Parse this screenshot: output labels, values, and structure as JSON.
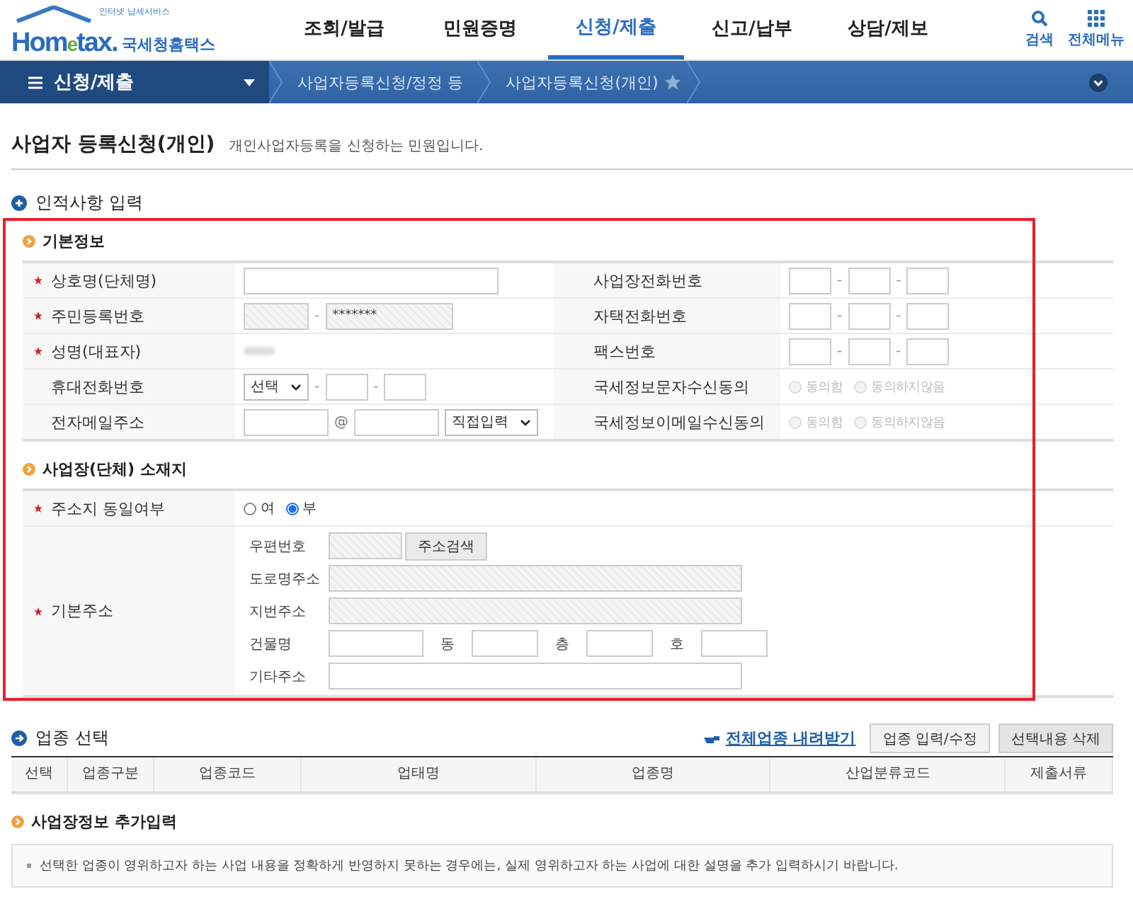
{
  "header": {
    "logo": {
      "tagline": "인터넷 납세서비스",
      "brand_a": "Hom",
      "brand_b": "e",
      "brand_c": "tax.",
      "name": "국세청홈택스"
    },
    "nav": [
      {
        "label": "조회/발급",
        "selected": false
      },
      {
        "label": "민원증명",
        "selected": false
      },
      {
        "label": "신청/제출",
        "selected": true
      },
      {
        "label": "신고/납부",
        "selected": false
      },
      {
        "label": "상담/제보",
        "selected": false
      }
    ],
    "tools": [
      {
        "kind": "search",
        "label": "검색"
      },
      {
        "kind": "menu",
        "label": "전체메뉴"
      }
    ]
  },
  "breadcrumb": {
    "menu": "신청/제출",
    "items": [
      "사업자등록신청/정정 등",
      "사업자등록신청(개인)"
    ]
  },
  "page": {
    "title": "사업자 등록신청(개인)",
    "subtitle": "개인사업자등록을 신청하는 민원입니다."
  },
  "personal": {
    "title": "인적사항 입력",
    "basic": {
      "title": "기본정보",
      "left_rows": [
        {
          "label": "상호명(단체명)",
          "required": true,
          "kind": "text"
        },
        {
          "label": "주민등록번호",
          "required": true,
          "kind": "rrn",
          "separator": "-",
          "value": "*******"
        },
        {
          "label": "성명(대표자)",
          "required": true,
          "kind": "blurred"
        },
        {
          "label": "휴대전화번호",
          "required": false,
          "kind": "mobile",
          "select": "선택",
          "separator": "-"
        },
        {
          "label": "전자메일주소",
          "required": false,
          "kind": "email",
          "at": "@",
          "select": "직접입력"
        }
      ],
      "right_rows": [
        {
          "label": "사업장전화번호",
          "kind": "phone",
          "separator": "-"
        },
        {
          "label": "자택전화번호",
          "kind": "phone",
          "separator": "-"
        },
        {
          "label": "팩스번호",
          "kind": "phone",
          "separator": "-"
        },
        {
          "label": "국세정보문자수신동의",
          "kind": "consent",
          "disabled": true,
          "options": [
            {
              "label": "동의함",
              "selected": false
            },
            {
              "label": "동의하지않음",
              "selected": false
            }
          ]
        },
        {
          "label": "국세정보이메일수신동의",
          "kind": "consent",
          "disabled": true,
          "options": [
            {
              "label": "동의함",
              "selected": false
            },
            {
              "label": "동의하지않음",
              "selected": false
            }
          ]
        }
      ]
    },
    "location": {
      "title": "사업장(단체) 소재지",
      "same": {
        "label": "주소지 동일여부",
        "required": true,
        "options": [
          {
            "label": "여",
            "selected": false
          },
          {
            "label": "부",
            "selected": true
          }
        ]
      },
      "address": {
        "label": "기본주소",
        "required": true,
        "zip": {
          "label": "우편번호",
          "button": "주소검색"
        },
        "road": {
          "label": "도로명주소"
        },
        "lot": {
          "label": "지번주소"
        },
        "building": {
          "label": "건물명",
          "parts": [
            "동",
            "층",
            "호"
          ]
        },
        "other": {
          "label": "기타주소"
        }
      }
    }
  },
  "industry": {
    "title": "업종 선택",
    "link": "전체업종 내려받기",
    "buttons": [
      "업종 입력/수정",
      "선택내용 삭제"
    ],
    "columns": [
      "선택",
      "업종구분",
      "업종코드",
      "업태명",
      "업종명",
      "산업분류코드",
      "제출서류"
    ]
  },
  "extra": {
    "title": "사업장정보 추가입력",
    "notes": [
      "선택한 업종이 영위하고자 하는 사업 내용을 정확하게 반영하지 못하는 경우에는, 실제 영위하고자 하는 사업에 대한 설명을 추가 입력하시기 바랍니다."
    ]
  }
}
